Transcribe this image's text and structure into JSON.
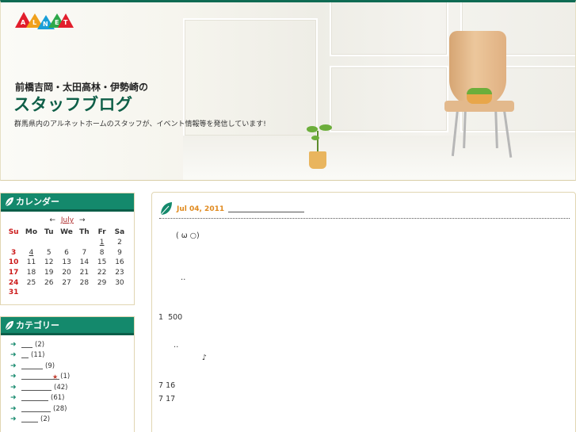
{
  "header": {
    "logo_letters": [
      "A",
      "L",
      "N",
      "E",
      "T"
    ],
    "title_sub": "前橋吉岡・太田高林・伊勢崎の",
    "title_main": "スタッフブログ",
    "description": "群馬県内のアルネットホームのスタッフが、イベント情報等を発信しています!"
  },
  "calendar": {
    "heading": "カレンダー",
    "prev": "←",
    "month": "July",
    "next": "→",
    "weekdays": [
      "Su",
      "Mo",
      "Tu",
      "We",
      "Th",
      "Fr",
      "Sa"
    ],
    "weeks": [
      [
        "",
        "",
        "",
        "",
        "",
        "1",
        "2"
      ],
      [
        "3",
        "4",
        "5",
        "6",
        "7",
        "8",
        "9"
      ],
      [
        "10",
        "11",
        "12",
        "13",
        "14",
        "15",
        "16"
      ],
      [
        "17",
        "18",
        "19",
        "20",
        "21",
        "22",
        "23"
      ],
      [
        "24",
        "25",
        "26",
        "27",
        "28",
        "29",
        "30"
      ],
      [
        "31",
        "",
        "",
        "",
        "",
        "",
        ""
      ]
    ],
    "linked_days": [
      "1",
      "4"
    ]
  },
  "categories": {
    "heading": "カテゴリー",
    "items": [
      {
        "count": "(2)"
      },
      {
        "count": "(11)"
      },
      {
        "count": "(9)"
      },
      {
        "count": "(1)",
        "star": "★"
      },
      {
        "count": "(42)"
      },
      {
        "count": "(61)"
      },
      {
        "count": "(28)"
      },
      {
        "count": "(2)"
      }
    ]
  },
  "entry": {
    "date": "Jul 04, 2011",
    "lines": [
      "( ω ○)",
      "‥",
      "1  500",
      "‥",
      "♪",
      "7 16",
      "7 17"
    ]
  },
  "colors": {
    "brand_green": "#14896c",
    "date_orange": "#e08a1e",
    "sunday_red": "#cc1b1b"
  }
}
